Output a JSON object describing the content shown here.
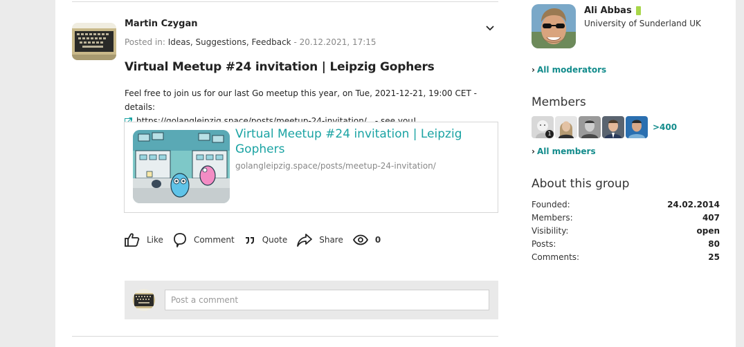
{
  "post": {
    "author": "Martin Czygan",
    "posted_in_label": "Posted in:",
    "categories": "Ideas, Suggestions, Feedback",
    "date_sep": "-",
    "date": "20.12.2021, 17:15",
    "title": "Virtual Meetup #24 invitation | Leipzig Gophers",
    "body_line1": "Feel free to join us for our last Go meetup this year, on Tue, 2021-12-21, 19:00 CET - details:",
    "link_url": "https://golangleipzig.space/posts/meetup-24-invitation/",
    "body_after_link": "- see you!",
    "preview": {
      "title": "Virtual Meetup #24 invitation | Leipzig Gophers",
      "domain_path": "golangleipzig.space/posts/meetup-24-invitation/"
    },
    "actions": {
      "like": "Like",
      "comment": "Comment",
      "quote": "Quote",
      "share": "Share",
      "views": "0"
    },
    "comment_placeholder": "Post a comment"
  },
  "sidebar": {
    "moderator": {
      "name": "Ali Abbas",
      "affiliation": "University of Sunderland UK",
      "status_color": "#a8d64a"
    },
    "all_moderators": "All moderators",
    "members_heading": "Members",
    "member_badge": "1",
    "more_members": ">400",
    "all_members": "All members",
    "about_heading": "About this group",
    "stats": [
      {
        "label": "Founded:",
        "value": "24.02.2014"
      },
      {
        "label": "Members:",
        "value": "407"
      },
      {
        "label": "Visibility:",
        "value": "open"
      },
      {
        "label": "Posts:",
        "value": "80"
      },
      {
        "label": "Comments:",
        "value": "25"
      }
    ]
  },
  "colors": {
    "accent": "#1aa3a3",
    "link": "#138c8c",
    "background": "#ebebeb"
  }
}
